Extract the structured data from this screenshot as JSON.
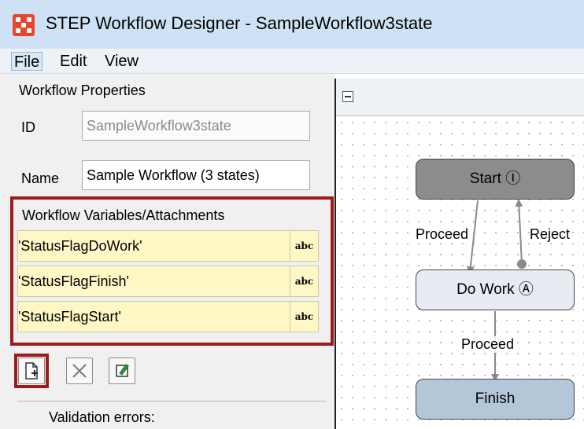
{
  "window": {
    "title": "STEP Workflow Designer - SampleWorkflow3state",
    "icon": "app-logo-icon"
  },
  "menu": [
    "File",
    "Edit",
    "View"
  ],
  "properties": {
    "heading": "Workflow Properties",
    "id_label": "ID",
    "id_value": "SampleWorkflow3state",
    "name_label": "Name",
    "name_value": "Sample Workflow (3 states)"
  },
  "variables": {
    "heading": "Workflow Variables/Attachments",
    "items": [
      {
        "name": "'StatusFlagDoWork'",
        "type": "abc"
      },
      {
        "name": "'StatusFlagFinish'",
        "type": "abc"
      },
      {
        "name": "'StatusFlagStart'",
        "type": "abc"
      }
    ]
  },
  "toolbar": {
    "buttons": [
      "add-variable-icon",
      "delete-icon",
      "edit-icon"
    ]
  },
  "validation": {
    "label": "Validation errors:"
  },
  "diagram": {
    "nodes": {
      "start": {
        "label": "Start",
        "glyph": "Ⓘ",
        "color": "#8c8c8c"
      },
      "do_work": {
        "label": "Do Work",
        "glyph": "Ⓐ",
        "color": "#e8ecf2"
      },
      "finish": {
        "label": "Finish",
        "glyph": "",
        "color": "#b4c7d9"
      }
    },
    "edges": {
      "proceed_1": "Proceed",
      "reject": "Reject",
      "proceed_2": "Proceed"
    }
  },
  "colors": {
    "highlight": "#9b1c1c",
    "variable_row": "#fff8c6",
    "titlebar": "#cfe2f5"
  }
}
